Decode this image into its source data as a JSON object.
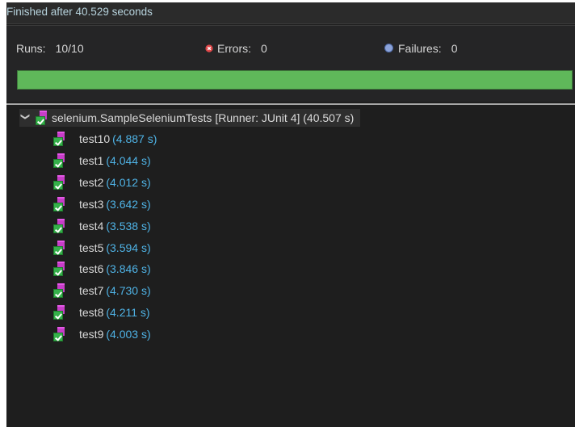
{
  "status": {
    "finished_text": "Finished after 40.529 seconds"
  },
  "summary": {
    "runs_label": "Runs:",
    "runs_value": "10/10",
    "errors_label": "Errors:",
    "errors_value": "0",
    "failures_label": "Failures:",
    "failures_value": "0",
    "progress_fraction": 1.0,
    "progress_color": "#5fb85a"
  },
  "tree": {
    "root": {
      "label": "selenium.SampleSeleniumTests [Runner: JUnit 4] (40.507 s)",
      "expanded": true,
      "icon": "test-suite-passed-icon"
    },
    "tests": [
      {
        "name": "test10",
        "time": "(4.887 s)"
      },
      {
        "name": "test1",
        "time": "(4.044 s)"
      },
      {
        "name": "test2",
        "time": "(4.012 s)"
      },
      {
        "name": "test3",
        "time": "(3.642 s)"
      },
      {
        "name": "test4",
        "time": "(3.538 s)"
      },
      {
        "name": "test5",
        "time": "(3.594 s)"
      },
      {
        "name": "test6",
        "time": "(3.846 s)"
      },
      {
        "name": "test7",
        "time": "(4.730 s)"
      },
      {
        "name": "test8",
        "time": "(4.211 s)"
      },
      {
        "name": "test9",
        "time": "(4.003 s)"
      }
    ]
  },
  "colors": {
    "background": "#1e1e1e",
    "time_text": "#4fb3e6",
    "pass_green": "#35b04a",
    "error_red": "#e0484a",
    "failure_blue": "#8ca3d9"
  }
}
